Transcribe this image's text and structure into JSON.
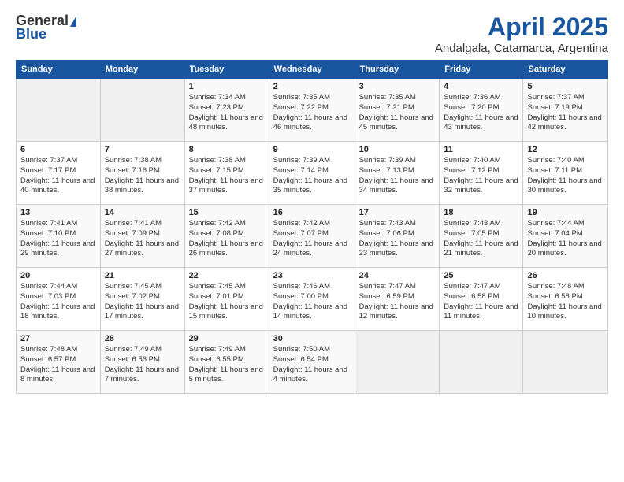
{
  "header": {
    "logo_general": "General",
    "logo_blue": "Blue",
    "month_title": "April 2025",
    "location": "Andalgala, Catamarca, Argentina"
  },
  "weekdays": [
    "Sunday",
    "Monday",
    "Tuesday",
    "Wednesday",
    "Thursday",
    "Friday",
    "Saturday"
  ],
  "weeks": [
    [
      {
        "day": "",
        "info": ""
      },
      {
        "day": "",
        "info": ""
      },
      {
        "day": "1",
        "info": "Sunrise: 7:34 AM\nSunset: 7:23 PM\nDaylight: 11 hours and 48 minutes."
      },
      {
        "day": "2",
        "info": "Sunrise: 7:35 AM\nSunset: 7:22 PM\nDaylight: 11 hours and 46 minutes."
      },
      {
        "day": "3",
        "info": "Sunrise: 7:35 AM\nSunset: 7:21 PM\nDaylight: 11 hours and 45 minutes."
      },
      {
        "day": "4",
        "info": "Sunrise: 7:36 AM\nSunset: 7:20 PM\nDaylight: 11 hours and 43 minutes."
      },
      {
        "day": "5",
        "info": "Sunrise: 7:37 AM\nSunset: 7:19 PM\nDaylight: 11 hours and 42 minutes."
      }
    ],
    [
      {
        "day": "6",
        "info": "Sunrise: 7:37 AM\nSunset: 7:17 PM\nDaylight: 11 hours and 40 minutes."
      },
      {
        "day": "7",
        "info": "Sunrise: 7:38 AM\nSunset: 7:16 PM\nDaylight: 11 hours and 38 minutes."
      },
      {
        "day": "8",
        "info": "Sunrise: 7:38 AM\nSunset: 7:15 PM\nDaylight: 11 hours and 37 minutes."
      },
      {
        "day": "9",
        "info": "Sunrise: 7:39 AM\nSunset: 7:14 PM\nDaylight: 11 hours and 35 minutes."
      },
      {
        "day": "10",
        "info": "Sunrise: 7:39 AM\nSunset: 7:13 PM\nDaylight: 11 hours and 34 minutes."
      },
      {
        "day": "11",
        "info": "Sunrise: 7:40 AM\nSunset: 7:12 PM\nDaylight: 11 hours and 32 minutes."
      },
      {
        "day": "12",
        "info": "Sunrise: 7:40 AM\nSunset: 7:11 PM\nDaylight: 11 hours and 30 minutes."
      }
    ],
    [
      {
        "day": "13",
        "info": "Sunrise: 7:41 AM\nSunset: 7:10 PM\nDaylight: 11 hours and 29 minutes."
      },
      {
        "day": "14",
        "info": "Sunrise: 7:41 AM\nSunset: 7:09 PM\nDaylight: 11 hours and 27 minutes."
      },
      {
        "day": "15",
        "info": "Sunrise: 7:42 AM\nSunset: 7:08 PM\nDaylight: 11 hours and 26 minutes."
      },
      {
        "day": "16",
        "info": "Sunrise: 7:42 AM\nSunset: 7:07 PM\nDaylight: 11 hours and 24 minutes."
      },
      {
        "day": "17",
        "info": "Sunrise: 7:43 AM\nSunset: 7:06 PM\nDaylight: 11 hours and 23 minutes."
      },
      {
        "day": "18",
        "info": "Sunrise: 7:43 AM\nSunset: 7:05 PM\nDaylight: 11 hours and 21 minutes."
      },
      {
        "day": "19",
        "info": "Sunrise: 7:44 AM\nSunset: 7:04 PM\nDaylight: 11 hours and 20 minutes."
      }
    ],
    [
      {
        "day": "20",
        "info": "Sunrise: 7:44 AM\nSunset: 7:03 PM\nDaylight: 11 hours and 18 minutes."
      },
      {
        "day": "21",
        "info": "Sunrise: 7:45 AM\nSunset: 7:02 PM\nDaylight: 11 hours and 17 minutes."
      },
      {
        "day": "22",
        "info": "Sunrise: 7:45 AM\nSunset: 7:01 PM\nDaylight: 11 hours and 15 minutes."
      },
      {
        "day": "23",
        "info": "Sunrise: 7:46 AM\nSunset: 7:00 PM\nDaylight: 11 hours and 14 minutes."
      },
      {
        "day": "24",
        "info": "Sunrise: 7:47 AM\nSunset: 6:59 PM\nDaylight: 11 hours and 12 minutes."
      },
      {
        "day": "25",
        "info": "Sunrise: 7:47 AM\nSunset: 6:58 PM\nDaylight: 11 hours and 11 minutes."
      },
      {
        "day": "26",
        "info": "Sunrise: 7:48 AM\nSunset: 6:58 PM\nDaylight: 11 hours and 10 minutes."
      }
    ],
    [
      {
        "day": "27",
        "info": "Sunrise: 7:48 AM\nSunset: 6:57 PM\nDaylight: 11 hours and 8 minutes."
      },
      {
        "day": "28",
        "info": "Sunrise: 7:49 AM\nSunset: 6:56 PM\nDaylight: 11 hours and 7 minutes."
      },
      {
        "day": "29",
        "info": "Sunrise: 7:49 AM\nSunset: 6:55 PM\nDaylight: 11 hours and 5 minutes."
      },
      {
        "day": "30",
        "info": "Sunrise: 7:50 AM\nSunset: 6:54 PM\nDaylight: 11 hours and 4 minutes."
      },
      {
        "day": "",
        "info": ""
      },
      {
        "day": "",
        "info": ""
      },
      {
        "day": "",
        "info": ""
      }
    ]
  ]
}
